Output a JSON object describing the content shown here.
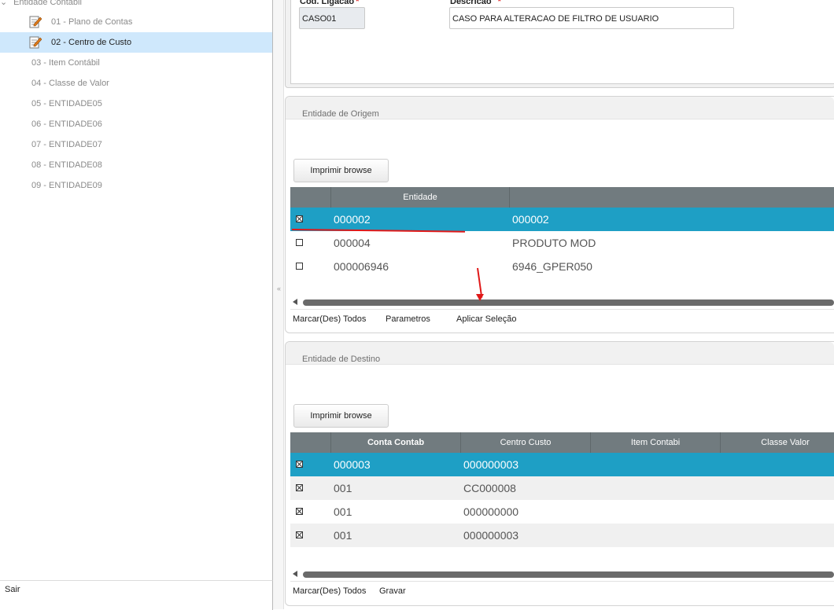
{
  "sidebar": {
    "root_label": "Entidade Contábil",
    "items": [
      {
        "label": "01 - Plano de Contas",
        "icon": "document-edit-icon"
      },
      {
        "label": "02 - Centro de Custo",
        "icon": "document-edit-icon",
        "selected": true
      },
      {
        "label": "03 - Item Contábil"
      },
      {
        "label": "04 - Classe de Valor"
      },
      {
        "label": "05 - ENTIDADE05"
      },
      {
        "label": "06 - ENTIDADE06"
      },
      {
        "label": "07 - ENTIDADE07"
      },
      {
        "label": "08 - ENTIDADE08"
      },
      {
        "label": "09 - ENTIDADE09"
      }
    ],
    "exit_label": "Sair"
  },
  "form": {
    "cod_label": "Cod. Ligacao",
    "cod_value": "CASO01",
    "desc_label": "Descricao",
    "desc_value": "CASO PARA ALTERACAO DE FILTRO DE USUARIO",
    "required_mark": "*"
  },
  "origem": {
    "title": "Entidade de Origem",
    "print_button": "Imprimir browse",
    "columns": [
      "",
      "Entidade",
      ""
    ],
    "rows": [
      {
        "checked": true,
        "c1": "000002",
        "c2": "000002",
        "selected": true
      },
      {
        "checked": false,
        "c1": "000004",
        "c2": "PRODUTO MOD"
      },
      {
        "checked": false,
        "c1": "000006946",
        "c2": "6946_GPER050"
      }
    ],
    "footer": {
      "mark_all": "Marcar(Des) Todos",
      "params": "Parametros",
      "apply": "Aplicar Seleção"
    }
  },
  "destino": {
    "title": "Entidade de Destino",
    "print_button": "Imprimir browse",
    "columns": [
      "",
      "Conta Contab",
      "Centro Custo",
      "Item Contabi",
      "Classe Valor"
    ],
    "rows": [
      {
        "checked": true,
        "c1": "000003",
        "c2": "000000003",
        "selected": true
      },
      {
        "checked": true,
        "c1": "001",
        "c2": "CC000008"
      },
      {
        "checked": true,
        "c1": "001",
        "c2": "000000000"
      },
      {
        "checked": true,
        "c1": "001",
        "c2": "000000003"
      }
    ],
    "footer": {
      "mark_all": "Marcar(Des) Todos",
      "save": "Gravar"
    }
  },
  "colors": {
    "selection": "#1e9fc5",
    "grid_header": "#717b7f",
    "tree_selected": "#cfe8fc",
    "annotation": "#e01818"
  }
}
